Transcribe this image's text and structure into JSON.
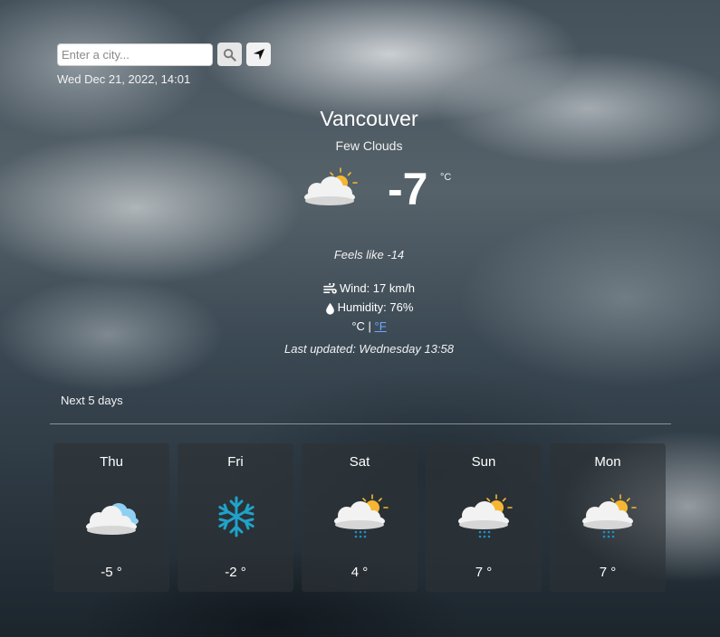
{
  "search": {
    "placeholder": "Enter a city..."
  },
  "toolbar": {
    "search_icon": "magnifier-icon",
    "locate_icon": "location-arrow-icon"
  },
  "datetime": "Wed Dec 21, 2022, 14:01",
  "current": {
    "city": "Vancouver",
    "condition": "Few Clouds",
    "icon": "cloud-sun-icon",
    "temperature": "-7",
    "unit": "°C",
    "feels_like": "Feels like -14",
    "wind": "Wind: 17 km/h",
    "humidity": "Humidity: 76%",
    "unit_c": "°C",
    "unit_separator": "|",
    "unit_f": "°F",
    "last_updated": "Last updated: Wednesday 13:58"
  },
  "forecast": {
    "heading": "Next 5 days",
    "days": [
      {
        "name": "Thu",
        "temp": "-5 °",
        "icon": "cloudy-icon"
      },
      {
        "name": "Fri",
        "temp": "-2 °",
        "icon": "snowflake-icon"
      },
      {
        "name": "Sat",
        "temp": "4 °",
        "icon": "rain-sun-icon"
      },
      {
        "name": "Sun",
        "temp": "7 °",
        "icon": "rain-sun-icon"
      },
      {
        "name": "Mon",
        "temp": "7 °",
        "icon": "rain-sun-icon"
      }
    ]
  },
  "colors": {
    "link": "#6fa8ff",
    "card_bg": "#2d3236",
    "sun": "#f5b731",
    "snow": "#1fa3c9"
  }
}
